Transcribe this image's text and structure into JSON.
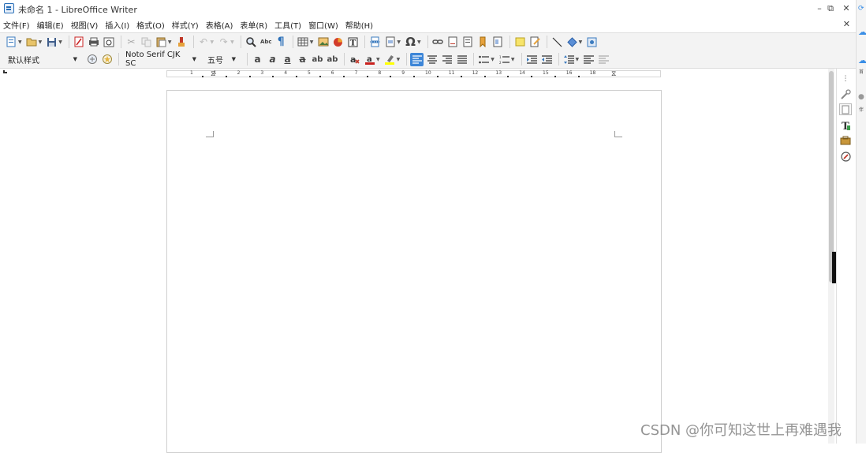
{
  "window": {
    "title": "未命名 1 - LibreOffice Writer",
    "controls": {
      "minimize": "–",
      "restore": "⧉",
      "close": "✕"
    },
    "doc_close": "✕"
  },
  "menu": [
    "文件(F)",
    "编辑(E)",
    "视图(V)",
    "插入(I)",
    "格式(O)",
    "样式(Y)",
    "表格(A)",
    "表单(R)",
    "工具(T)",
    "窗口(W)",
    "帮助(H)"
  ],
  "toolbar_standard": {
    "icons": [
      "new-document-icon",
      "open-folder-icon",
      "save-icon",
      "export-pdf-icon",
      "print-icon",
      "print-preview-icon",
      "cut-icon",
      "copy-icon",
      "paste-icon",
      "clone-formatting-icon",
      "undo-icon",
      "redo-icon",
      "find-replace-icon",
      "spellcheck-icon",
      "formatting-marks-icon",
      "insert-table-icon",
      "insert-image-icon",
      "insert-chart-icon",
      "insert-textbox-icon",
      "insert-page-break-icon",
      "insert-field-icon",
      "special-character-icon",
      "hyperlink-icon",
      "footnote-icon",
      "endnote-icon",
      "bookmark-icon",
      "cross-reference-icon",
      "comment-icon",
      "track-changes-icon",
      "line-icon",
      "basic-shapes-icon",
      "draw-functions-icon"
    ],
    "spellcheck_glyph": "Abc",
    "special_char_glyph": "Ω",
    "pilcrow_glyph": "¶"
  },
  "toolbar_formatting": {
    "paragraph_style": "默认样式",
    "font_name": "Noto Serif CJK SC",
    "font_size": "五号",
    "align_left_active": true
  },
  "ruler": {
    "labels": [
      "1",
      "1",
      "2",
      "3",
      "4",
      "5",
      "6",
      "7",
      "8",
      "9",
      "10",
      "11",
      "12",
      "13",
      "14",
      "15",
      "16",
      "18"
    ]
  },
  "sidebar": {
    "icons": [
      "sidebar-menu-icon",
      "properties-icon",
      "page-icon",
      "styles-icon",
      "gallery-icon",
      "navigator-icon"
    ]
  },
  "outside_labels": [
    "首",
    "伴"
  ],
  "watermark": "CSDN @你可知这世上再难遇我"
}
